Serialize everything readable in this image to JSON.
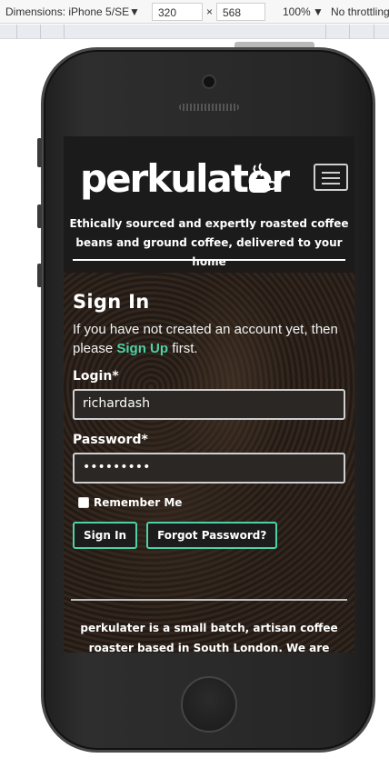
{
  "devtools": {
    "dimensions_label": "Dimensions: iPhone 5/SE",
    "width": "320",
    "times": "×",
    "height": "568",
    "zoom": "100%",
    "throttling": "No throttling"
  },
  "site": {
    "brand": "perkulater",
    "menu_icon": "hamburger-menu-icon",
    "tagline": "Ethically sourced and expertly roasted coffee beans and ground coffee, delivered to your home"
  },
  "signin": {
    "title": "Sign In",
    "intro_prefix": "If you have not created an account yet, then please ",
    "intro_link": "Sign Up",
    "intro_suffix": " first.",
    "login_label": "Login*",
    "login_value": "richardash",
    "password_label": "Password*",
    "password_value": "•••••••••",
    "remember_label": "Remember Me",
    "remember_checked": false,
    "signin_button": "Sign In",
    "forgot_button": "Forgot Password?"
  },
  "footer": {
    "text": "perkulater is a small batch, artisan coffee roaster based in South London. We are committed to"
  },
  "colors": {
    "accent": "#4fd1a5",
    "header_bg": "#1b1b1b"
  }
}
